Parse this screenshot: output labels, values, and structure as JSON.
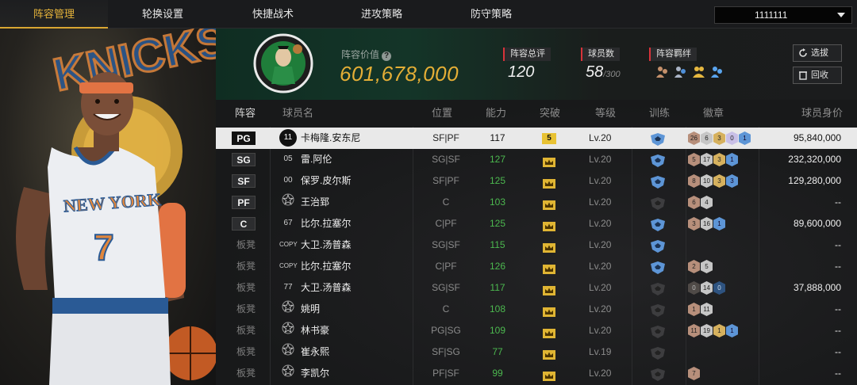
{
  "nav": {
    "tabs": [
      "阵容管理",
      "轮换设置",
      "快捷战术",
      "进攻策略",
      "防守策略"
    ],
    "active_tab": 0,
    "dropdown_value": "1111111"
  },
  "header": {
    "value_label": "阵容价值",
    "value": "601,678,000",
    "overall_label": "阵容总评",
    "overall_value": "120",
    "players_label": "球员数",
    "players_value": "58",
    "players_max": "/300",
    "chemistry_label": "阵容羁绊",
    "select_button": "选拔",
    "recycle_button": "回收",
    "logo_text": "BOSTON CELTICS"
  },
  "table": {
    "columns": [
      "阵容",
      "球员名",
      "位置",
      "能力",
      "突破",
      "等级",
      "训练",
      "徽章",
      "球员身价"
    ],
    "rows": [
      {
        "slot": "PG",
        "starter": true,
        "num": "11",
        "name": "卡梅隆.安东尼",
        "pos": "SF|PF",
        "rating": "117",
        "break": "5",
        "level": "Lv.20",
        "train": "blue",
        "badges": [
          [
            "b",
            "26"
          ],
          [
            "s",
            "6"
          ],
          [
            "g",
            "3"
          ],
          [
            "p",
            "0"
          ],
          [
            "l",
            "1"
          ]
        ],
        "price": "95,840,000"
      },
      {
        "slot": "SG",
        "starter": true,
        "num": "05",
        "name": "雷.阿伦",
        "pos": "SG|SF",
        "rating": "127",
        "break": "crown",
        "level": "Lv.20",
        "train": "blue",
        "badges": [
          [
            "b",
            "5"
          ],
          [
            "s",
            "17"
          ],
          [
            "g",
            "3"
          ],
          [
            "l",
            "1"
          ]
        ],
        "price": "232,320,000"
      },
      {
        "slot": "SF",
        "starter": true,
        "num": "00",
        "name": "保罗.皮尔斯",
        "pos": "SF|PF",
        "rating": "125",
        "break": "crown",
        "level": "Lv.20",
        "train": "blue",
        "badges": [
          [
            "b",
            "8"
          ],
          [
            "s",
            "10"
          ],
          [
            "g",
            "3"
          ],
          [
            "l",
            "3"
          ]
        ],
        "price": "129,280,000"
      },
      {
        "slot": "PF",
        "starter": true,
        "num": "star",
        "name": "王治郅",
        "pos": "C",
        "rating": "103",
        "break": "crown",
        "level": "Lv.20",
        "train": "gray",
        "badges": [
          [
            "b",
            "6"
          ],
          [
            "s",
            "4"
          ]
        ],
        "price": "--"
      },
      {
        "slot": "C",
        "starter": true,
        "num": "67",
        "name": "比尔.拉塞尔",
        "pos": "C|PF",
        "rating": "125",
        "break": "crown",
        "level": "Lv.20",
        "train": "blue",
        "badges": [
          [
            "b",
            "3"
          ],
          [
            "s",
            "16"
          ],
          [
            "l",
            "1"
          ]
        ],
        "price": "89,600,000"
      },
      {
        "slot": "板凳",
        "starter": false,
        "num": "COPY",
        "name": "大卫.汤普森",
        "pos": "SG|SF",
        "rating": "115",
        "break": "crown",
        "level": "Lv.20",
        "train": "blue",
        "badges": [],
        "price": "--"
      },
      {
        "slot": "板凳",
        "starter": false,
        "num": "COPY",
        "name": "比尔.拉塞尔",
        "pos": "C|PF",
        "rating": "126",
        "break": "crown",
        "level": "Lv.20",
        "train": "blue",
        "badges": [
          [
            "b",
            "2"
          ],
          [
            "s",
            "5"
          ]
        ],
        "price": "--"
      },
      {
        "slot": "板凳",
        "starter": false,
        "num": "77",
        "name": "大卫.汤普森",
        "pos": "SG|SF",
        "rating": "117",
        "break": "crown",
        "level": "Lv.20",
        "train": "gray",
        "badges": [
          [
            "d",
            "0"
          ],
          [
            "s",
            "14"
          ],
          [
            "dl",
            "0"
          ]
        ],
        "price": "37,888,000"
      },
      {
        "slot": "板凳",
        "starter": false,
        "num": "star",
        "name": "姚明",
        "pos": "C",
        "rating": "108",
        "break": "crown",
        "level": "Lv.20",
        "train": "gray",
        "badges": [
          [
            "b",
            "1"
          ],
          [
            "s",
            "11"
          ]
        ],
        "price": "--"
      },
      {
        "slot": "板凳",
        "starter": false,
        "num": "star",
        "name": "林书豪",
        "pos": "PG|SG",
        "rating": "109",
        "break": "crown",
        "level": "Lv.20",
        "train": "gray",
        "badges": [
          [
            "b",
            "11"
          ],
          [
            "s",
            "19"
          ],
          [
            "g",
            "1"
          ],
          [
            "l",
            "1"
          ]
        ],
        "price": "--"
      },
      {
        "slot": "板凳",
        "starter": false,
        "num": "star",
        "name": "崔永熙",
        "pos": "SF|SG",
        "rating": "77",
        "break": "crown",
        "level": "Lv.19",
        "train": "gray",
        "badges": [],
        "price": "--"
      },
      {
        "slot": "板凳",
        "starter": false,
        "num": "star",
        "name": "李凯尔",
        "pos": "PF|SF",
        "rating": "99",
        "break": "crown",
        "level": "Lv.20",
        "train": "gray",
        "badges": [
          [
            "b",
            "7"
          ]
        ],
        "price": "--"
      }
    ]
  },
  "portrait": {
    "jersey_city": "NEW YORK",
    "jersey_number": "7",
    "team_wordmark": "KNICKS"
  },
  "colors": {
    "accent": "#e4ae36",
    "rating_green": "#4cb84f",
    "selected_row": "#e9e9e9"
  }
}
